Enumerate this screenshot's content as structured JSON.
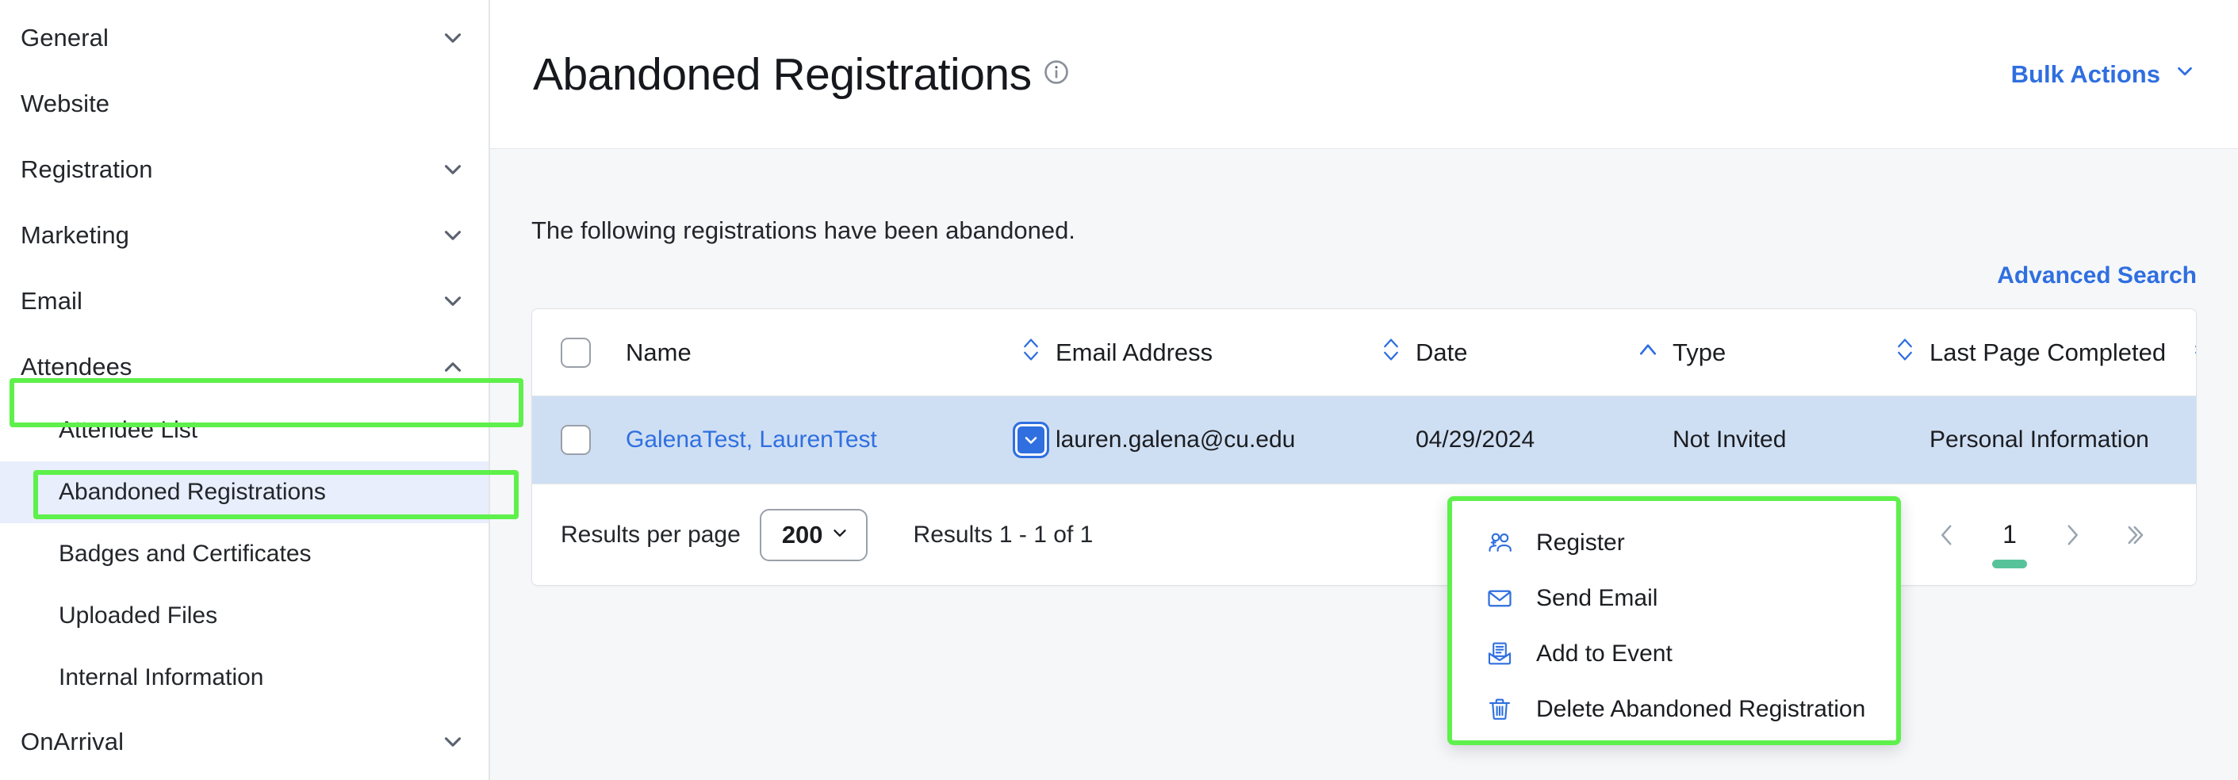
{
  "sidebar": {
    "groups": [
      {
        "label": "General",
        "chevron": "chevron-down-icon",
        "expanded": false
      },
      {
        "label": "Website",
        "chevron": "",
        "expanded": false
      },
      {
        "label": "Registration",
        "chevron": "chevron-down-icon",
        "expanded": false
      },
      {
        "label": "Marketing",
        "chevron": "chevron-down-icon",
        "expanded": false
      },
      {
        "label": "Email",
        "chevron": "chevron-down-icon",
        "expanded": false
      },
      {
        "label": "Attendees",
        "chevron": "chevron-up-icon",
        "expanded": true
      },
      {
        "label": "OnArrival",
        "chevron": "chevron-down-icon",
        "expanded": false
      }
    ],
    "attendees_children": [
      {
        "label": "Attendee List",
        "active": false
      },
      {
        "label": "Abandoned Registrations",
        "active": true
      },
      {
        "label": "Badges and Certificates",
        "active": false
      },
      {
        "label": "Uploaded Files",
        "active": false
      },
      {
        "label": "Internal Information",
        "active": false
      }
    ]
  },
  "header": {
    "title": "Abandoned Registrations",
    "info_icon": "info-icon",
    "bulk_actions_label": "Bulk Actions",
    "bulk_actions_chevron": "chevron-down-icon"
  },
  "content": {
    "intro_text": "The following registrations have been abandoned.",
    "advanced_search_label": "Advanced Search"
  },
  "table": {
    "columns": [
      {
        "label": "Name",
        "sort": "none"
      },
      {
        "label": "Email Address",
        "sort": "none"
      },
      {
        "label": "Date",
        "sort": "asc"
      },
      {
        "label": "Type",
        "sort": "none"
      },
      {
        "label": "Last Page Completed",
        "sort": "none"
      }
    ],
    "rows": [
      {
        "selected": false,
        "name": "GalenaTest, LaurenTest",
        "email": "lauren.galena@cu.edu",
        "date": "04/29/2024",
        "type": "Not Invited",
        "last_page_completed": "Personal Information",
        "menu_open": true
      }
    ]
  },
  "footer": {
    "results_per_page_label": "Results per page",
    "results_per_page_value": "200",
    "results_text": "Results 1 - 1 of 1",
    "pagination": {
      "first_icon": "double-chevron-left-icon",
      "prev_icon": "chevron-left-icon",
      "current_page": "1",
      "next_icon": "chevron-right-icon",
      "last_icon": "double-chevron-right-icon"
    }
  },
  "row_menu": {
    "items": [
      {
        "label": "Register",
        "icon": "add-users-icon"
      },
      {
        "label": "Send Email",
        "icon": "envelope-icon"
      },
      {
        "label": "Add to Event",
        "icon": "document-envelope-icon"
      },
      {
        "label": "Delete Abandoned Registration",
        "icon": "trash-icon"
      }
    ]
  },
  "colors": {
    "accent_blue": "#2f6fe0",
    "row_selected": "#cfdff3",
    "highlight_green": "#5ef04b",
    "page_indicator_teal": "#57c39a",
    "panel_bg": "#f6f7f9"
  }
}
